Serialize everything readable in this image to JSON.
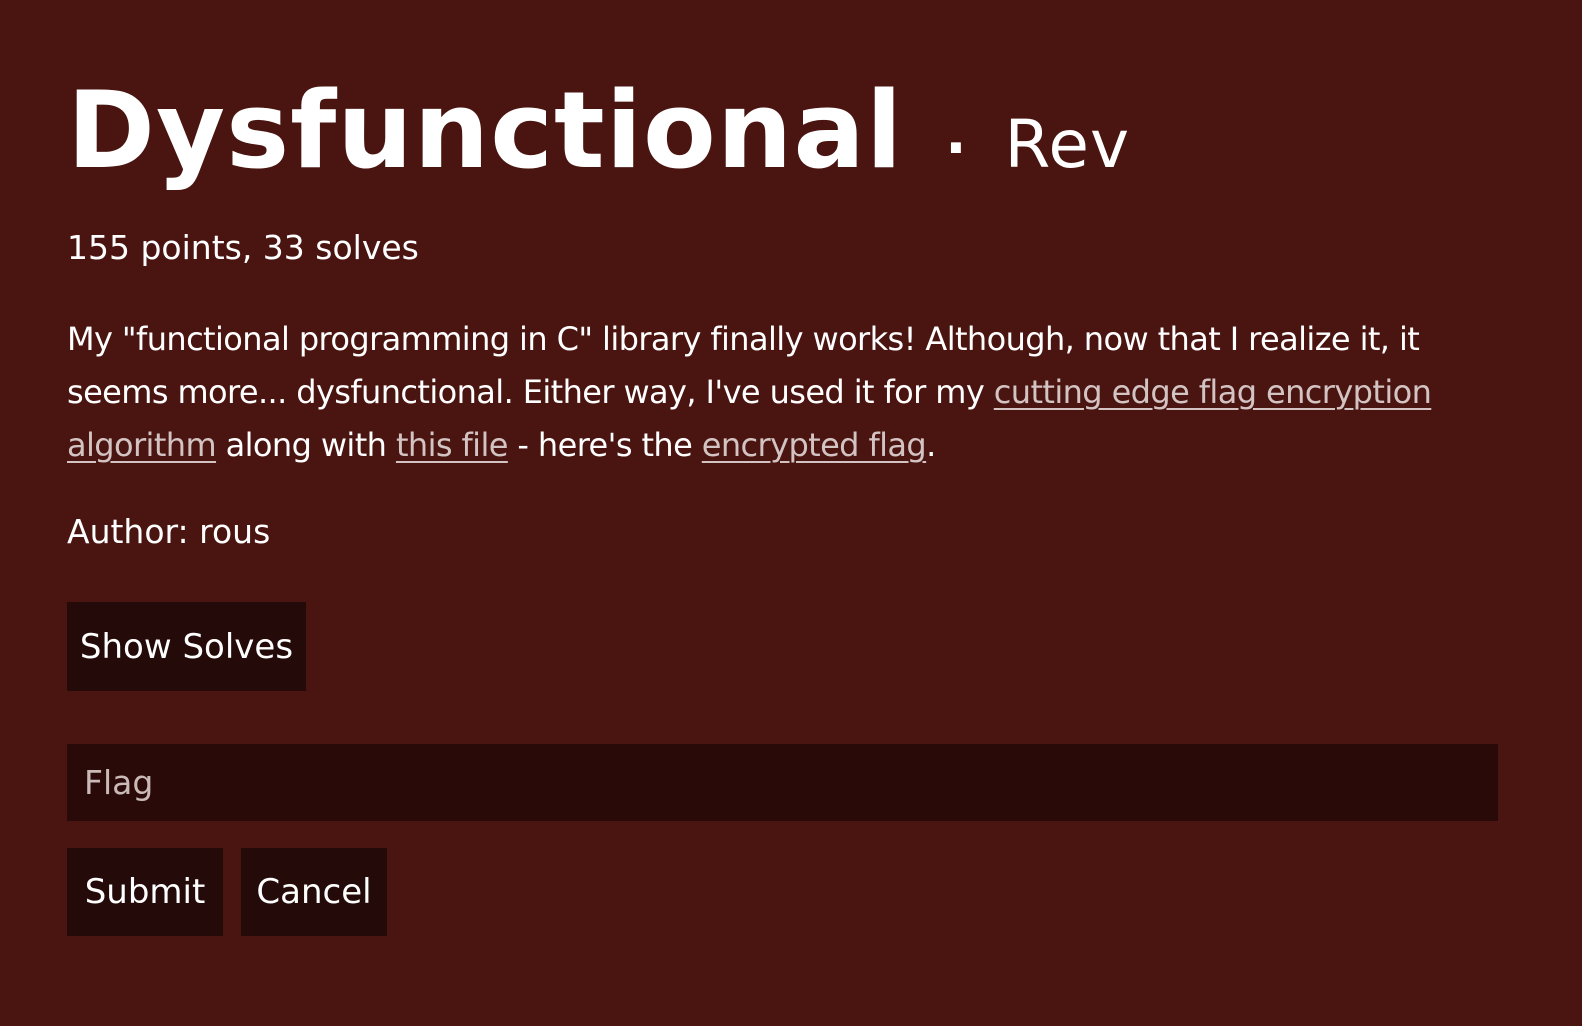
{
  "challenge": {
    "title": "Dysfunctional",
    "separator": "·",
    "category": "Rev",
    "meta": "155 points, 33 solves",
    "description": {
      "part1": "My \"functional programming in C\" library finally works! Although, now that I realize it, it seems more... dysfunctional. Either way, I've used it for my ",
      "link1": "cutting edge flag encryption algorithm",
      "part2": " along with ",
      "link2": "this file",
      "part3": " - here's the ",
      "link3": "encrypted flag",
      "part4": "."
    },
    "author": "Author: rous"
  },
  "buttons": {
    "show_solves": "Show Solves",
    "submit": "Submit",
    "cancel": "Cancel"
  },
  "flag_input": {
    "placeholder": "Flag",
    "value": ""
  },
  "colors": {
    "background": "#4a1511",
    "button_bg": "#240a08",
    "input_bg": "#2a0a09",
    "link": "#d3c4c3",
    "text": "#ffffff"
  }
}
